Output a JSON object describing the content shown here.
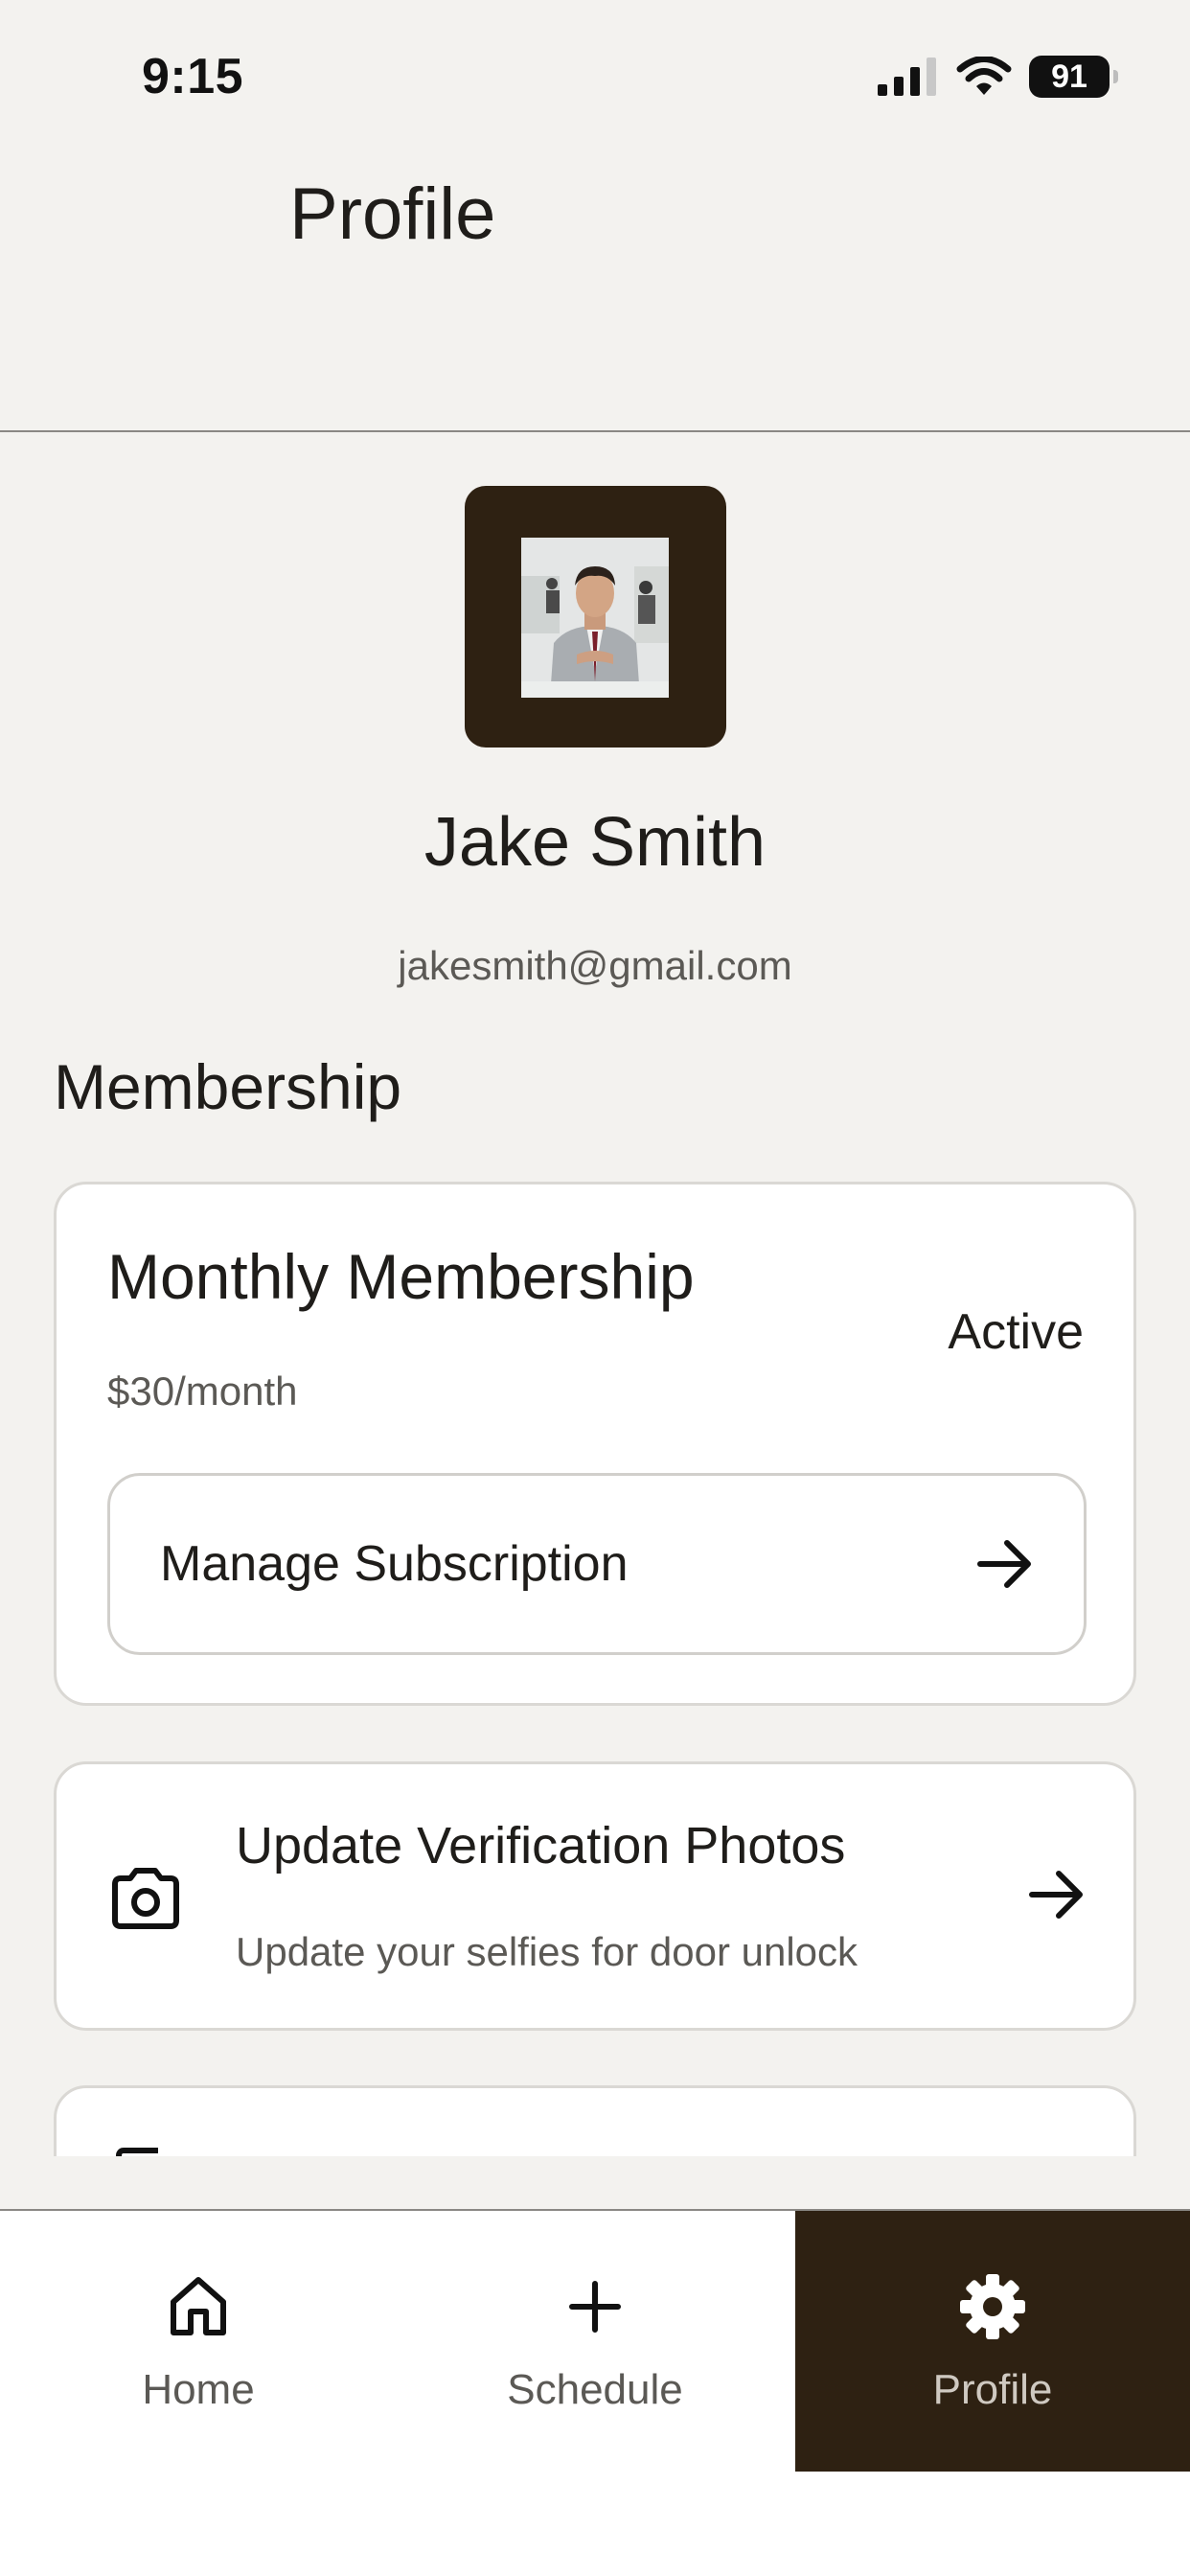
{
  "status_bar": {
    "time": "9:15",
    "battery": "91"
  },
  "header": {
    "title": "Profile"
  },
  "profile": {
    "name": "Jake Smith",
    "email": "jakesmith@gmail.com"
  },
  "membership_section": {
    "title": "Membership",
    "plan_name": "Monthly Membership",
    "status": "Active",
    "price": "$30/month",
    "manage_label": "Manage Subscription"
  },
  "verification": {
    "title": "Update Verification Photos",
    "subtitle": "Update your selfies for door unlock"
  },
  "tabs": [
    {
      "label": "Home",
      "icon": "home-icon"
    },
    {
      "label": "Schedule",
      "icon": "plus-icon"
    },
    {
      "label": "Profile",
      "icon": "gear-icon",
      "active": true
    }
  ],
  "colors": {
    "accent_dark": "#2e2112",
    "background": "#f3f2ef",
    "card": "#ffffff",
    "muted_text": "#5b5955"
  }
}
